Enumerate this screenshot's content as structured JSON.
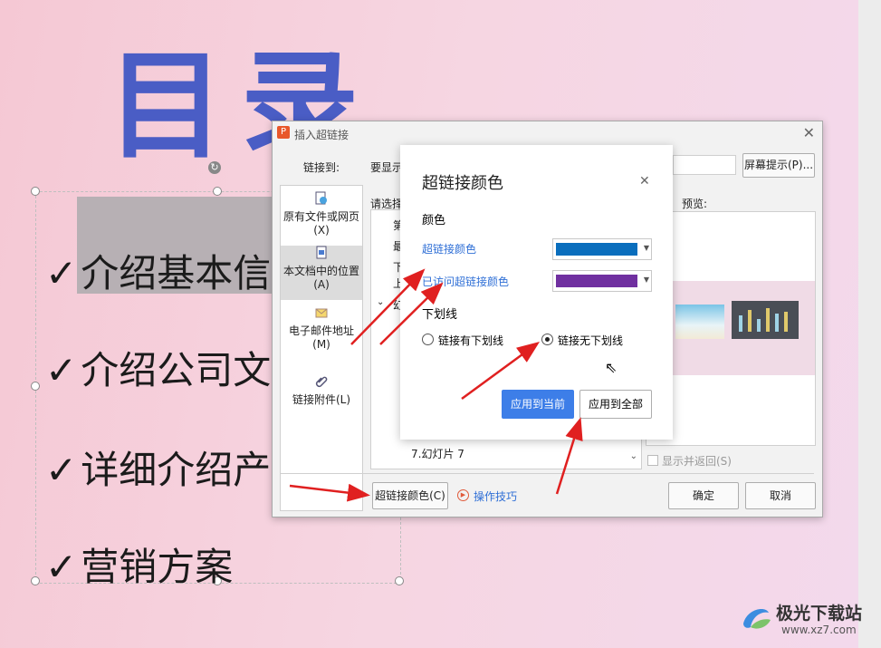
{
  "slide": {
    "title": "目录",
    "bullets": [
      "介绍基本信",
      "介绍公司文",
      "详细介绍产",
      "营销方案"
    ],
    "check": "✓"
  },
  "dialog": {
    "title": "插入超链接",
    "link_to_label": "链接到:",
    "display_text_label": "要显示",
    "screen_tip_button": "屏幕提示(P)...",
    "select_label": "请选择",
    "preview_label": "预览:",
    "nav": [
      {
        "label": "原有文件或网页(X)",
        "icon": "globe-file-icon"
      },
      {
        "label": "本文档中的位置(A)",
        "icon": "document-place-icon"
      },
      {
        "label": "电子邮件地址(M)",
        "icon": "email-icon"
      },
      {
        "label": "链接附件(L)",
        "icon": "paperclip-icon"
      }
    ],
    "tree_items": [
      "第",
      "最",
      "下",
      "上",
      "幻",
      "7.幻灯片 7"
    ],
    "show_return_label": "显示并返回(S)",
    "hyperlink_color_button": "超链接颜色(C)",
    "tips_link": "操作技巧",
    "ok_button": "确定",
    "cancel_button": "取消"
  },
  "popup": {
    "title": "超链接颜色",
    "color_section": "颜色",
    "hyperlink_color_label": "超链接颜色",
    "hyperlink_color": "#0a6ebd",
    "visited_color_label": "已访问超链接颜色",
    "visited_color": "#7030a0",
    "underline_section": "下划线",
    "radio_with_underline": "链接有下划线",
    "radio_without_underline": "链接无下划线",
    "selected_underline": "链接无下划线",
    "apply_current_button": "应用到当前",
    "apply_all_button": "应用到全部"
  },
  "watermark": {
    "brand": "极光下载站",
    "url": "www.xz7.com"
  },
  "colors": {
    "title_blue": "#4a5dc5",
    "primary_button": "#3d7ee8",
    "arrow_red": "#e02020",
    "link_color": "#2f6fd6"
  }
}
